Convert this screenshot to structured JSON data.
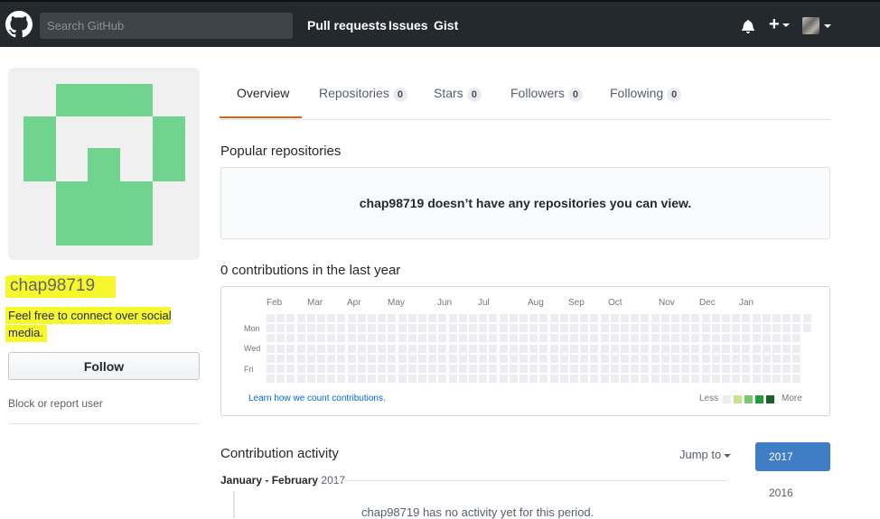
{
  "header": {
    "search_placeholder": "Search GitHub",
    "nav": [
      "Pull requests",
      "Issues",
      "Gist"
    ],
    "plus_label": "+"
  },
  "profile": {
    "username": "chap98719",
    "bio": "Feel free to connect over social media.",
    "follow_label": "Follow",
    "block_label": "Block or report user"
  },
  "tabs": [
    {
      "label": "Overview",
      "count": null
    },
    {
      "label": "Repositories",
      "count": "0"
    },
    {
      "label": "Stars",
      "count": "0"
    },
    {
      "label": "Followers",
      "count": "0"
    },
    {
      "label": "Following",
      "count": "0"
    }
  ],
  "popular": {
    "title": "Popular repositories",
    "empty_message": "chap98719 doesn’t have any repositories you can view."
  },
  "contributions": {
    "title": "0 contributions in the last year",
    "months": [
      "Feb",
      "Mar",
      "Apr",
      "May",
      "Jun",
      "Jul",
      "Aug",
      "Sep",
      "Oct",
      "Nov",
      "Dec",
      "Jan"
    ],
    "days": [
      "Mon",
      "Wed",
      "Fri"
    ],
    "learn_link": "Learn how we count contributions.",
    "legend_less": "Less",
    "legend_more": "More",
    "legend_colors": [
      "#ebedf0",
      "#c6e48b",
      "#7bc96f",
      "#239a3b",
      "#196127"
    ],
    "cell_color": "#ebedf0"
  },
  "activity": {
    "title": "Contribution activity",
    "jump_label": "Jump to",
    "years": [
      "2017",
      "2016"
    ],
    "period_label": "January - February",
    "period_year": "2017",
    "empty_text": "chap98719 has no activity yet for this period."
  },
  "colors": {
    "header_bg": "#24292e",
    "avatar_green": "#70d38e",
    "highlight": "#f7f72d",
    "year_active_bg": "#3f7ec5",
    "tab_underline": "#e36209"
  }
}
